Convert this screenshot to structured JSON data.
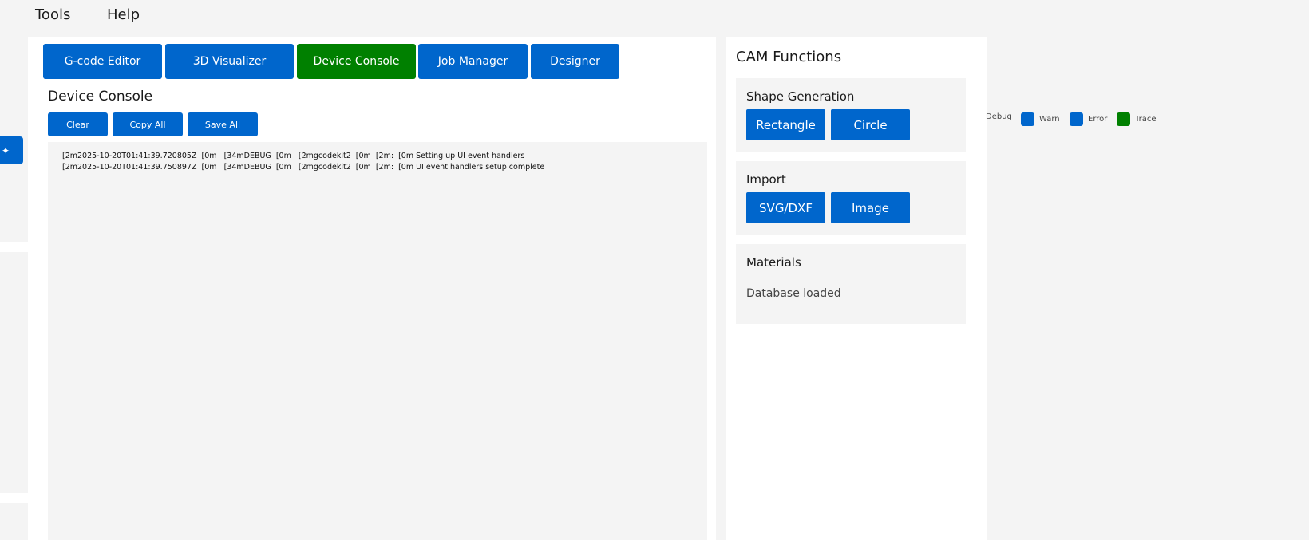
{
  "menu": {
    "tools": "Tools",
    "help": "Help"
  },
  "tabs": [
    {
      "label": "G-code Editor",
      "active": false
    },
    {
      "label": "3D Visualizer",
      "active": false
    },
    {
      "label": "Device Console",
      "active": true
    },
    {
      "label": "Job Manager",
      "active": false
    },
    {
      "label": "Designer",
      "active": false
    }
  ],
  "console": {
    "title": "Device Console",
    "buttons": {
      "clear": "Clear",
      "copy_all": "Copy All",
      "save_all": "Save All"
    },
    "lines": [
      "[2m2025-10-20T01:41:39.720805Z  [0m   [34mDEBUG  [0m   [2mgcodekit2  [0m  [2m:  [0m Setting up UI event handlers",
      "[2m2025-10-20T01:41:39.750897Z  [0m   [34mDEBUG  [0m   [2mgcodekit2  [0m  [2m:  [0m UI event handlers setup complete"
    ]
  },
  "cam": {
    "title": "CAM Functions",
    "shape_generation": {
      "title": "Shape Generation",
      "rectangle": "Rectangle",
      "circle": "Circle"
    },
    "import": {
      "title": "Import",
      "svg_dxf": "SVG/DXF",
      "image": "Image"
    },
    "materials": {
      "title": "Materials",
      "status": "Database loaded"
    }
  },
  "log_filters": [
    {
      "label": "Debug",
      "color": null
    },
    {
      "label": "Warn",
      "color": "#0066cc"
    },
    {
      "label": "Error",
      "color": "#0066cc"
    },
    {
      "label": "Trace",
      "color": "#008000"
    }
  ],
  "colors": {
    "accent": "#0066cc",
    "active": "#008000",
    "panel": "#f4f4f4"
  }
}
